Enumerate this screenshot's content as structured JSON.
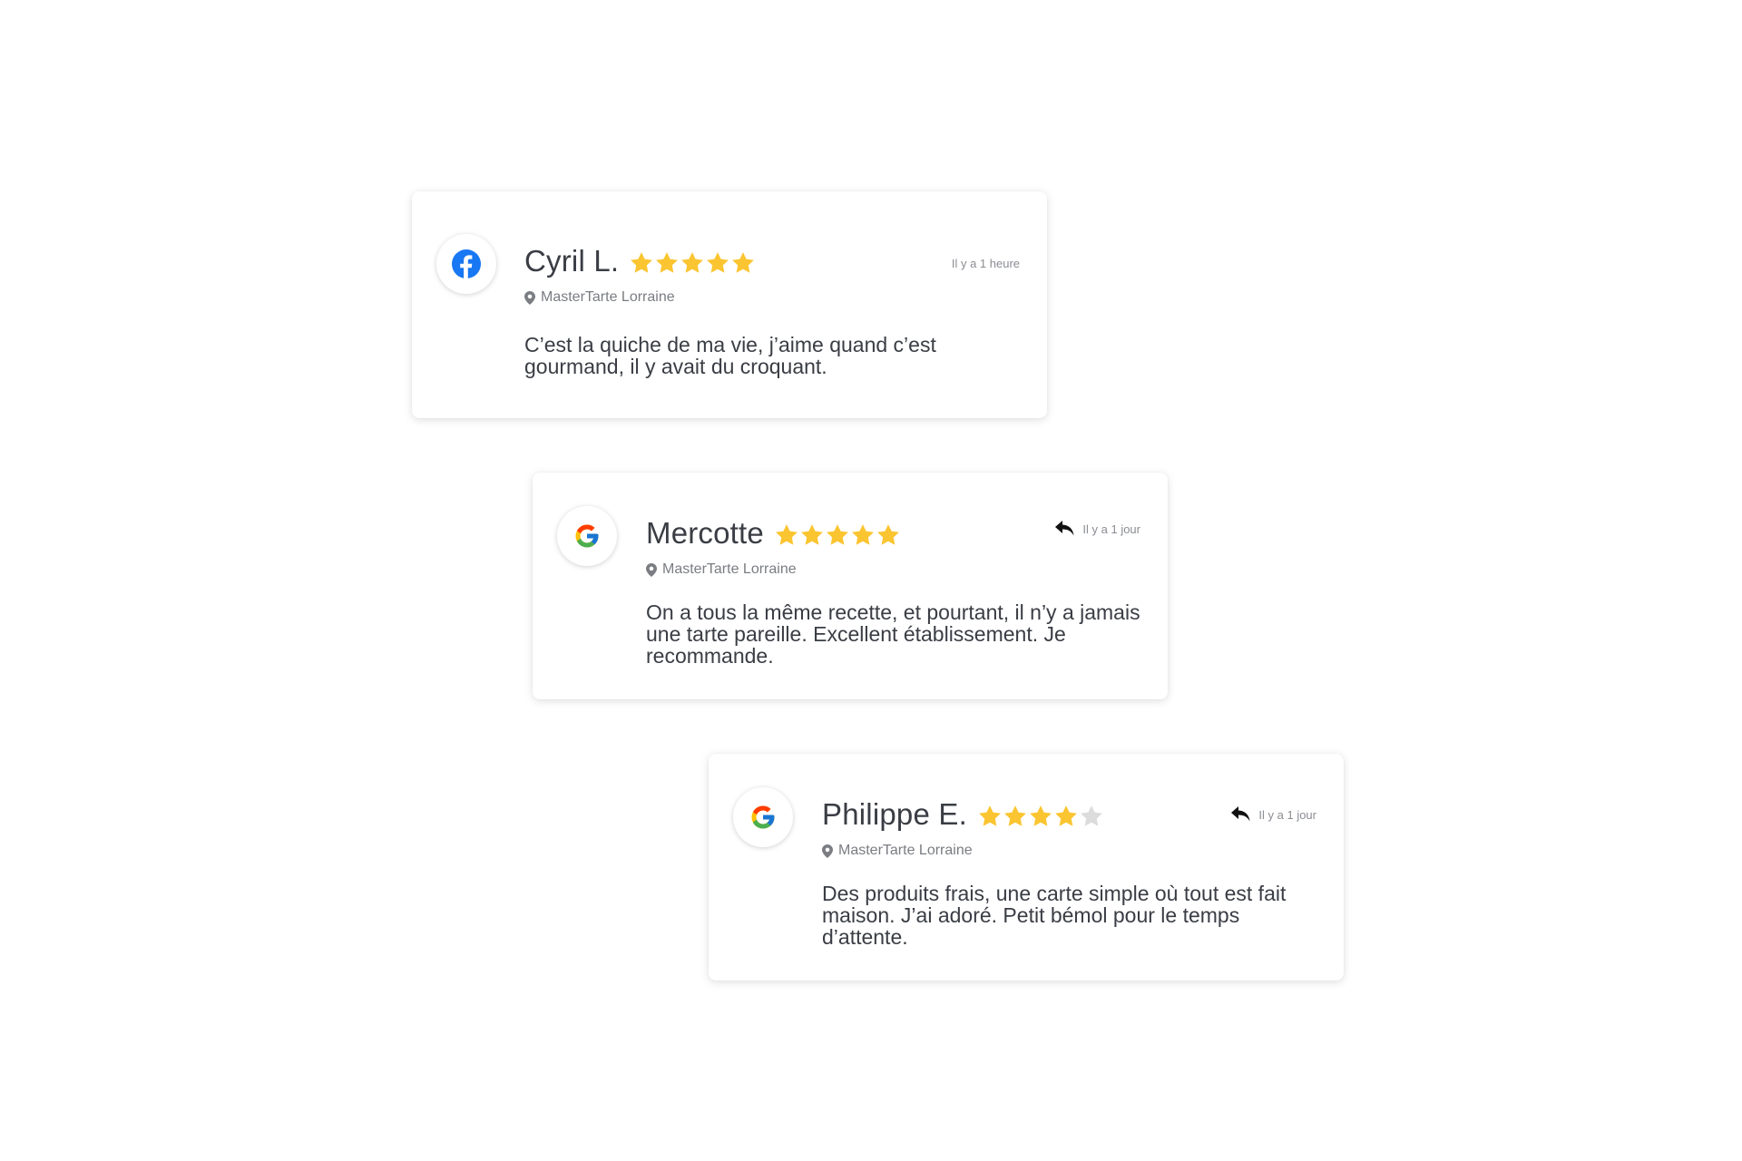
{
  "reviews": [
    {
      "source": "facebook",
      "source_icon": "facebook-icon",
      "name": "Cyril L.",
      "rating": 5,
      "max_rating": 5,
      "location": "MasterTarte Lorraine",
      "timestamp": "Il y a 1 heure",
      "has_reply": false,
      "text": "C’est la quiche de ma vie, j’aime quand c’est gourmand, il y avait du croquant."
    },
    {
      "source": "google",
      "source_icon": "google-icon",
      "name": "Mercotte",
      "rating": 5,
      "max_rating": 5,
      "location": "MasterTarte Lorraine",
      "timestamp": "Il y a 1 jour",
      "has_reply": true,
      "text": "On a tous la même recette, et pourtant, il n’y a jamais une tarte pareille. Excellent établissement. Je recommande."
    },
    {
      "source": "google",
      "source_icon": "google-icon",
      "name": "Philippe E.",
      "rating": 4,
      "max_rating": 5,
      "location": "MasterTarte Lorraine",
      "timestamp": "Il y a 1 jour",
      "has_reply": true,
      "text": "Des produits frais, une carte simple où tout est fait maison. J’ai adoré. Petit bémol pour le temps d’attente."
    }
  ],
  "colors": {
    "star_filled": "#FBC531",
    "star_empty": "#DCDCDC",
    "facebook_blue": "#1877F2",
    "google_blue": "#4285F4",
    "google_red": "#EA4335",
    "google_yellow": "#FBBC05",
    "google_green": "#34A853",
    "pin": "#7a7d82"
  }
}
